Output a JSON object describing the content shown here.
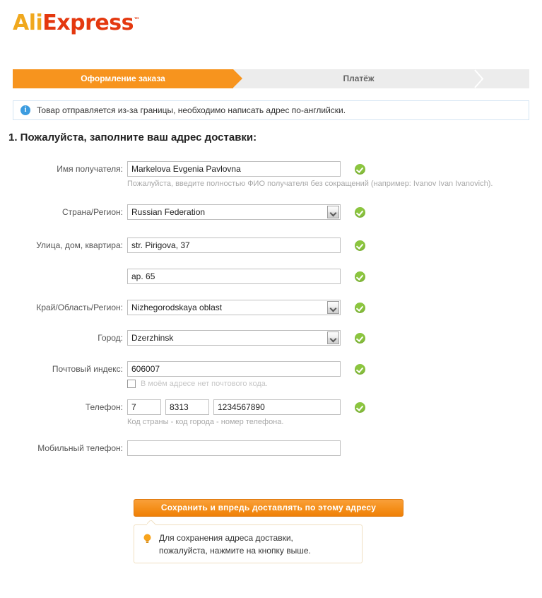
{
  "brand": {
    "name_part1": "Ali",
    "name_part2": "Express",
    "trademark": "™",
    "orange": "#f0a81e",
    "red": "#e4380f"
  },
  "steps": [
    {
      "label": "Оформление заказа",
      "active": true
    },
    {
      "label": "Платёж",
      "active": false
    }
  ],
  "notice": {
    "icon": "info-icon",
    "text": "Товар отправляется из-за границы, необходимо написать адрес по-английски."
  },
  "section": {
    "title": "1. Пожалуйста, заполните ваш адрес доставки:"
  },
  "form": {
    "recipient": {
      "label": "Имя получателя:",
      "value": "Markelova Evgenia Pavlovna",
      "hint": "Пожалуйста, введите полностью ФИО получателя без сокращений (например: Ivanov Ivan Ivanovich).",
      "valid": true
    },
    "country": {
      "label": "Страна/Регион:",
      "value": "Russian Federation",
      "valid": true
    },
    "street": {
      "label": "Улица, дом, квартира:",
      "value": "str. Pirigova, 37",
      "valid": true
    },
    "street2": {
      "label": "",
      "value": "ap. 65",
      "valid": true
    },
    "region": {
      "label": "Край/Область/Регион:",
      "value": "Nizhegorodskaya oblast",
      "valid": true
    },
    "city": {
      "label": "Город:",
      "value": "Dzerzhinsk",
      "valid": true
    },
    "zip": {
      "label": "Почтовый индекс:",
      "value": "606007",
      "valid": true,
      "no_zip_label": "В моём адресе нет почтового кода.",
      "no_zip_checked": false
    },
    "phone": {
      "label": "Телефон:",
      "country_code": "7",
      "city_code": "8313",
      "number": "1234567890",
      "hint": "Код страны - код города - номер телефона.",
      "valid": true
    },
    "mobile": {
      "label": "Мобильный телефон:",
      "value": "",
      "placeholder": ""
    }
  },
  "save_button": {
    "label": "Сохранить и впредь доставлять по этому адресу"
  },
  "tooltip": {
    "icon": "lightbulb-icon",
    "line1": "Для сохранения адреса доставки,",
    "line2": "пожалуйста, нажмите на кнопку выше."
  },
  "colors": {
    "accent_orange": "#f7941e",
    "valid_green": "#8cc63f",
    "info_blue": "#3c9ce0"
  }
}
